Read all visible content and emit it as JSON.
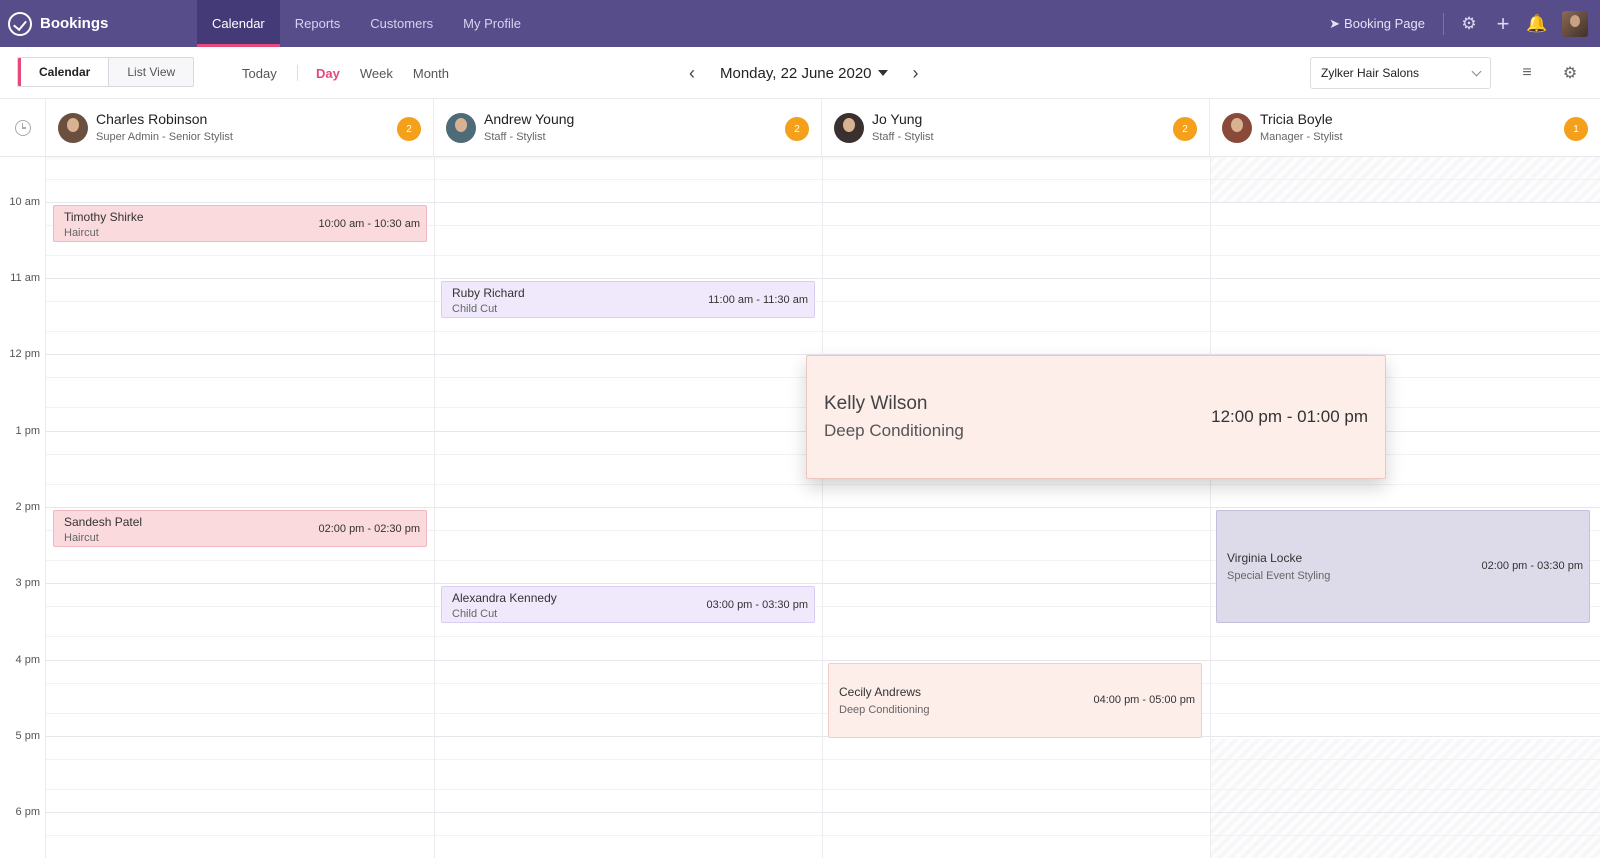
{
  "app": {
    "name": "Bookings"
  },
  "nav": {
    "links": [
      {
        "label": "Calendar",
        "active": true
      },
      {
        "label": "Reports",
        "active": false
      },
      {
        "label": "Customers",
        "active": false
      },
      {
        "label": "My Profile",
        "active": false
      }
    ],
    "booking_page_label": "Booking Page",
    "icons": [
      "cursor-icon",
      "gear-icon",
      "plus-icon",
      "bell-icon"
    ]
  },
  "toolbar": {
    "view_toggle": [
      {
        "label": "Calendar",
        "active": true
      },
      {
        "label": "List View",
        "active": false
      }
    ],
    "today_label": "Today",
    "ranges": [
      {
        "label": "Day",
        "active": true
      },
      {
        "label": "Week",
        "active": false
      },
      {
        "label": "Month",
        "active": false
      }
    ],
    "date_label": "Monday, 22 June 2020",
    "location_select": "Zylker Hair Salons"
  },
  "colors": {
    "nav_bg": "#574d8a",
    "accent": "#e5497a",
    "badge": "#f5a01a"
  },
  "staff": [
    {
      "name": "Charles Robinson",
      "role": "Super Admin - Senior Stylist",
      "count": "2"
    },
    {
      "name": "Andrew Young",
      "role": "Staff - Stylist",
      "count": "2"
    },
    {
      "name": "Jo Yung",
      "role": "Staff - Stylist",
      "count": "2"
    },
    {
      "name": "Tricia Boyle",
      "role": "Manager - Stylist",
      "count": "1"
    }
  ],
  "time_labels": [
    "10 am",
    "11 am",
    "12 pm",
    "1 pm",
    "2 pm",
    "3 pm",
    "4 pm",
    "5 pm",
    "6 pm"
  ],
  "appointments": [
    {
      "staff": 0,
      "customer": "Timothy Shirke",
      "service": "Haircut",
      "time": "10:00 am - 10:30 am",
      "color": "pink"
    },
    {
      "staff": 1,
      "customer": "Ruby Richard",
      "service": "Child Cut",
      "time": "11:00 am - 11:30 am",
      "color": "lavender"
    },
    {
      "staff": 0,
      "customer": "Sandesh Patel",
      "service": "Haircut",
      "time": "02:00 pm - 02:30 pm",
      "color": "pink"
    },
    {
      "staff": 3,
      "customer": "Virginia Locke",
      "service": "Special Event Styling",
      "time": "02:00 pm - 03:30 pm",
      "color": "slate"
    },
    {
      "staff": 1,
      "customer": "Alexandra Kennedy",
      "service": "Child Cut",
      "time": "03:00 pm - 03:30 pm",
      "color": "lavender"
    },
    {
      "staff": 2,
      "customer": "Cecily Andrews",
      "service": "Deep Conditioning",
      "time": "04:00 pm - 05:00 pm",
      "color": "peach"
    }
  ],
  "popup": {
    "customer": "Kelly Wilson",
    "service": "Deep Conditioning",
    "time": "12:00 pm - 01:00 pm"
  }
}
